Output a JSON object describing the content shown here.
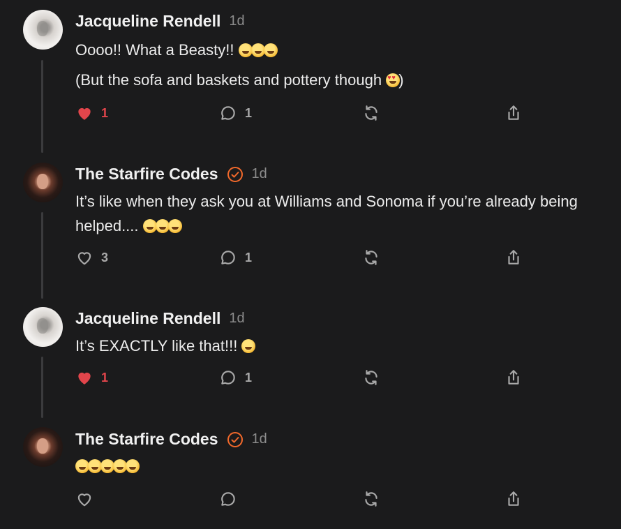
{
  "colors": {
    "background": "#1b1b1c",
    "like_active": "#e2454b",
    "verified_badge": "#f2692b",
    "icon_muted": "#a9a9a9",
    "timestamp": "#8c8c8c"
  },
  "comments": [
    {
      "author": "Jacqueline Rendell",
      "time": "1d",
      "verified": false,
      "text": "Oooo!! What a Beasty!!",
      "text_emoji": "🤣🤣🤣",
      "text2": "(But the sofa and baskets and pottery though",
      "text2_emoji": "😍",
      "text2_end": ")",
      "likes": "1",
      "liked": true,
      "replies": "1"
    },
    {
      "author": "The Starfire Codes",
      "time": "1d",
      "verified": true,
      "text": "It’s like when they ask you at Williams and Sonoma if you’re already being helped....",
      "text_emoji": "🤣🤣🤣",
      "likes": "3",
      "liked": false,
      "replies": "1"
    },
    {
      "author": "Jacqueline Rendell",
      "time": "1d",
      "verified": false,
      "text": "It’s EXACTLY like that!!!",
      "text_emoji": "🤣",
      "likes": "1",
      "liked": true,
      "replies": "1"
    },
    {
      "author": "The Starfire Codes",
      "time": "1d",
      "verified": true,
      "text": "",
      "text_emoji": "🤣🤣🤣🤣🤣",
      "likes": "",
      "liked": false,
      "replies": ""
    }
  ],
  "icons": {
    "like": "heart-icon",
    "reply": "comment-bubble-icon",
    "restack": "restack-icon",
    "share": "share-icon",
    "verified": "verified-check-icon"
  }
}
